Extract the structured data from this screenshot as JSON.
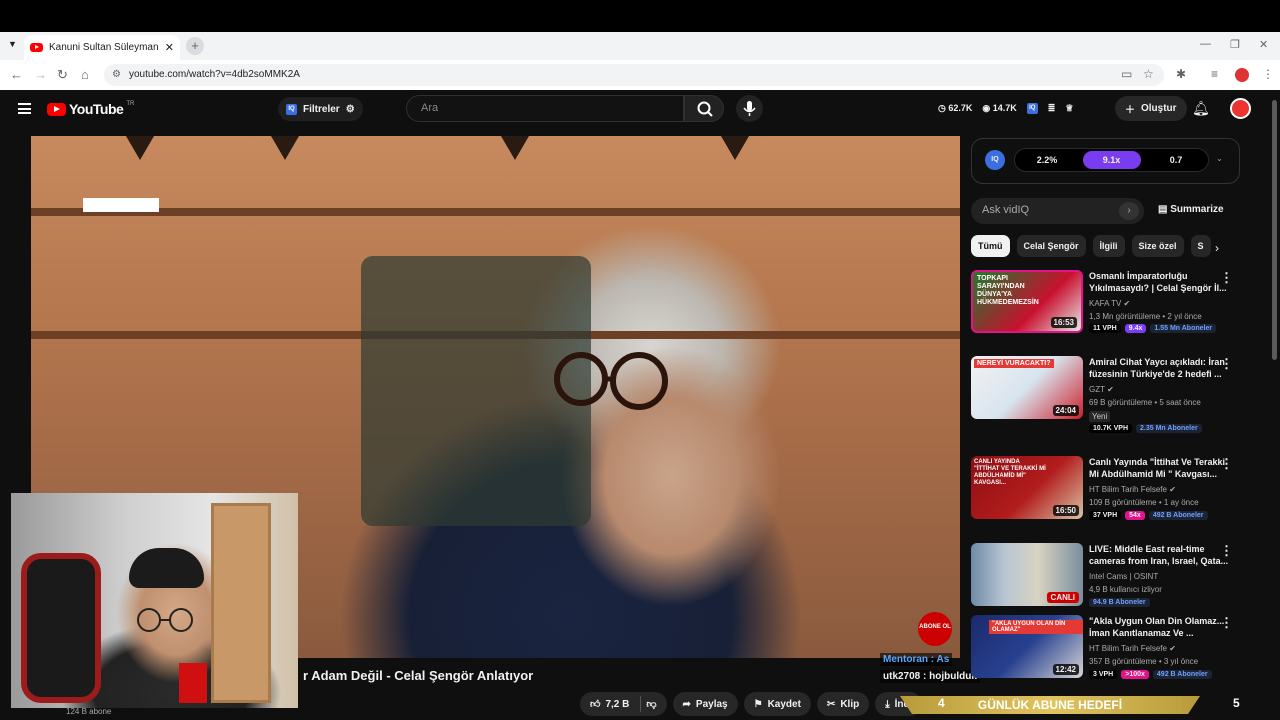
{
  "browser": {
    "tab_title": "Kanuni Sultan Süleyman Ciddiye",
    "new_tab": "+",
    "url": "youtube.com/watch?v=4db2soMMK2A"
  },
  "header": {
    "logo": "YouTube",
    "region": "TR",
    "filters_label": "Filtreler",
    "search_placeholder": "Ara",
    "stat_views": "62.7K",
    "stat_subs": "14.7K",
    "create_label": "Oluştur"
  },
  "video": {
    "title": "r Adam Değil - Celal Şengör Anlatıyor",
    "channel_subs": "124 B abone",
    "abone_overlay": "ABONE OL",
    "like_count": "7,2 B",
    "share_label": "Paylaş",
    "save_label": "Kaydet",
    "clip_label": "Klip",
    "download_label": "İndi"
  },
  "overlay": {
    "chat_user1": "Mentoran : As",
    "chat_line2": "utk2708 : hojbulduk",
    "banner_left": "4",
    "banner_text": "GÜNLÜK ABUNE HEDEFİ",
    "banner_right": "5"
  },
  "vidiq": {
    "badge": "IQ",
    "metric1": "2.2%",
    "metric2": "9.1x",
    "metric3": "0.7",
    "ask_placeholder": "Ask vidIQ",
    "summarize": "Summarize"
  },
  "chips": [
    "Tümü",
    "Celal Şengör",
    "İlgili",
    "Size özel",
    "S"
  ],
  "recommendations": [
    {
      "title": "Osmanlı İmparatorluğu Yıkılmasaydı? | Celal Şengör İl...",
      "channel": "KAFA TV",
      "meta": "1,3 Mn görüntüleme • 2 yıl önce",
      "duration": "16:53",
      "thumb_text": "TOPKAPI SARAYI'NDAN DÜNYA'YA HÜKMEDEMEZSİN",
      "vph": "11 VPH",
      "mult": "9.4x",
      "subs": "1.55 Mn Aboneler",
      "mult_color": "#7a3cf0"
    },
    {
      "title": "Amiral Cihat Yaycı açıkladı: İran füzesinin Türkiye'de 2 hedefi ...",
      "channel": "GZT",
      "meta": "69 B görüntüleme • 5 saat önce",
      "extra": "Yeni",
      "duration": "24:04",
      "thumb_text": "NEREYİ VURACAKTI?",
      "vph": "10.7K VPH",
      "mult": "",
      "subs": "2.35 Mn Aboneler",
      "mult_color": "#000000"
    },
    {
      "title": "Canlı Yayında \"İttihat Ve Terakki Mi Abdülhamid Mi \" Kavgası...",
      "channel": "HT Bilim Tarih Felsefe",
      "meta": "109 B görüntüleme • 1 ay önce",
      "duration": "16:50",
      "thumb_text": "CANLI YAYINDA \"İTTİHAT VE TERAKKİ Mİ ABDÜLHAMİD Mİ\" KAVGASI...",
      "vph": "37 VPH",
      "mult": "54x",
      "subs": "492 B Aboneler",
      "mult_color": "#e0138a"
    },
    {
      "title": "LIVE: Middle East real-time cameras from Iran, Israel, Qata...",
      "channel": "Intel Cams | OSINT",
      "meta": "4,9 B kullanıcı izliyor",
      "duration": "CANLI",
      "thumb_text": "",
      "vph": "",
      "mult": "",
      "subs": "94.9 B Aboneler",
      "mult_color": "#000000"
    },
    {
      "title": "\"Akla Uygun Olan Din Olamaz... İman Kanıtlanamaz Ve ...",
      "channel": "HT Bilim Tarih Felsefe",
      "meta": "357 B görüntüleme • 3 yıl önce",
      "duration": "12:42",
      "thumb_text": "\"AKLA UYGUN OLAN DİN OLAMAZ\"",
      "vph": "3 VPH",
      "mult": ">100x",
      "subs": "492 B Aboneler",
      "mult_color": "#e0138a"
    }
  ],
  "colors": {
    "brand_red": "#ff0000",
    "vidiq_purple": "#7a3cf0",
    "sub_blue": "#6fa0ff"
  }
}
